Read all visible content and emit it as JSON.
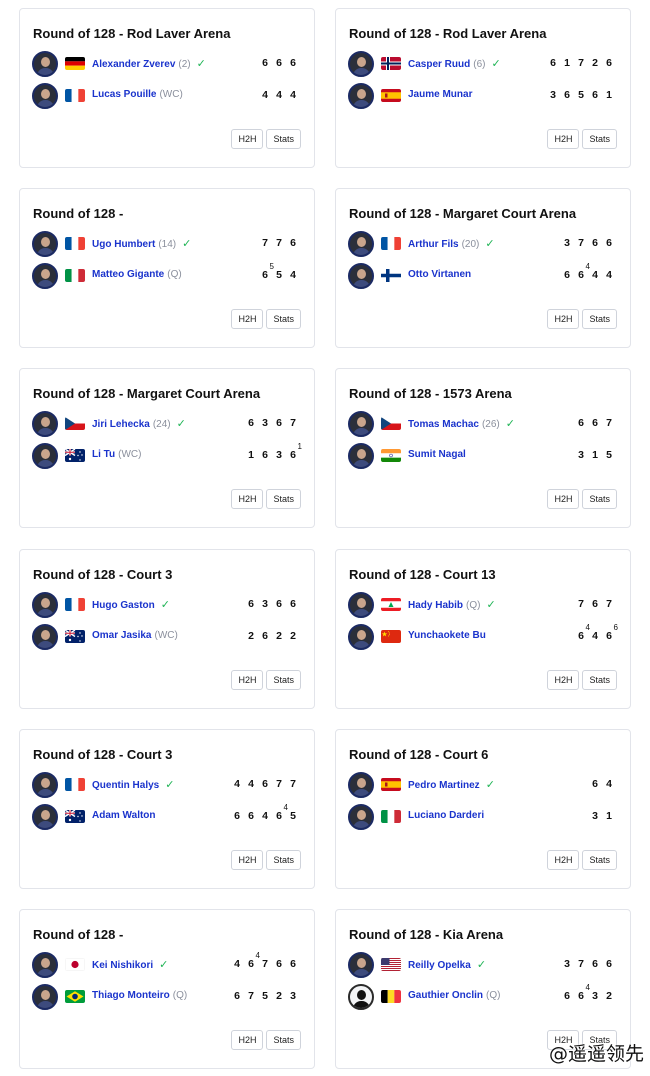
{
  "brand_colors": {
    "player_link": "#1a33cc",
    "winner_check": "#1fb455",
    "seed": "#8a8f9c",
    "card_border": "#e2e4ea"
  },
  "buttons": {
    "h2h": "H2H",
    "stats": "Stats"
  },
  "icons": {
    "winner": "check-icon",
    "avatar": "player-avatar"
  },
  "watermark": "@遥遥领先",
  "matches": [
    {
      "title": "Round of 128 - Rod Laver Arena",
      "players": [
        {
          "name": "Alexander Zverev",
          "seed": "(2)",
          "flag": "germany",
          "winner": true,
          "scores": [
            "6",
            "6",
            "6"
          ],
          "tiebreaks": [
            "",
            "",
            ""
          ]
        },
        {
          "name": "Lucas Pouille",
          "seed": "(WC)",
          "flag": "france",
          "winner": false,
          "scores": [
            "4",
            "4",
            "4"
          ],
          "tiebreaks": [
            "",
            "",
            ""
          ]
        }
      ]
    },
    {
      "title": "Round of 128 - Rod Laver Arena",
      "players": [
        {
          "name": "Casper Ruud",
          "seed": "(6)",
          "flag": "norway",
          "winner": true,
          "scores": [
            "6",
            "1",
            "7",
            "2",
            "6"
          ],
          "tiebreaks": [
            "",
            "",
            "",
            "",
            ""
          ]
        },
        {
          "name": "Jaume Munar",
          "seed": "",
          "flag": "spain",
          "winner": false,
          "scores": [
            "3",
            "6",
            "5",
            "6",
            "1"
          ],
          "tiebreaks": [
            "",
            "",
            "",
            "",
            ""
          ]
        }
      ]
    },
    {
      "title": "Round of 128 -",
      "players": [
        {
          "name": "Ugo Humbert",
          "seed": "(14)",
          "flag": "france",
          "winner": true,
          "scores": [
            "7",
            "7",
            "6"
          ],
          "tiebreaks": [
            "",
            "",
            ""
          ]
        },
        {
          "name": "Matteo Gigante",
          "seed": "(Q)",
          "flag": "italy",
          "winner": false,
          "scores": [
            "6",
            "5",
            "4"
          ],
          "tiebreaks": [
            "5",
            "",
            ""
          ]
        }
      ]
    },
    {
      "title": "Round of 128 - Margaret Court Arena",
      "players": [
        {
          "name": "Arthur Fils",
          "seed": "(20)",
          "flag": "france",
          "winner": true,
          "scores": [
            "3",
            "7",
            "6",
            "6"
          ],
          "tiebreaks": [
            "",
            "",
            "",
            ""
          ]
        },
        {
          "name": "Otto Virtanen",
          "seed": "",
          "flag": "finland",
          "winner": false,
          "scores": [
            "6",
            "6",
            "4",
            "4"
          ],
          "tiebreaks": [
            "",
            "4",
            "",
            ""
          ]
        }
      ]
    },
    {
      "title": "Round of 128 - Margaret Court Arena",
      "players": [
        {
          "name": "Jiri Lehecka",
          "seed": "(24)",
          "flag": "czechia",
          "winner": true,
          "scores": [
            "6",
            "3",
            "6",
            "7"
          ],
          "tiebreaks": [
            "",
            "",
            "",
            ""
          ]
        },
        {
          "name": "Li Tu",
          "seed": "(WC)",
          "flag": "australia",
          "winner": false,
          "scores": [
            "1",
            "6",
            "3",
            "6"
          ],
          "tiebreaks": [
            "",
            "",
            "",
            "1"
          ]
        }
      ]
    },
    {
      "title": "Round of 128 - 1573 Arena",
      "players": [
        {
          "name": "Tomas Machac",
          "seed": "(26)",
          "flag": "czechia",
          "winner": true,
          "scores": [
            "6",
            "6",
            "7"
          ],
          "tiebreaks": [
            "",
            "",
            ""
          ]
        },
        {
          "name": "Sumit Nagal",
          "seed": "",
          "flag": "india",
          "winner": false,
          "scores": [
            "3",
            "1",
            "5"
          ],
          "tiebreaks": [
            "",
            "",
            ""
          ]
        }
      ]
    },
    {
      "title": "Round of 128 - Court 3",
      "players": [
        {
          "name": "Hugo Gaston",
          "seed": "",
          "flag": "france",
          "winner": true,
          "scores": [
            "6",
            "3",
            "6",
            "6"
          ],
          "tiebreaks": [
            "",
            "",
            "",
            ""
          ]
        },
        {
          "name": "Omar Jasika",
          "seed": "(WC)",
          "flag": "australia",
          "winner": false,
          "scores": [
            "2",
            "6",
            "2",
            "2"
          ],
          "tiebreaks": [
            "",
            "",
            "",
            ""
          ]
        }
      ]
    },
    {
      "title": "Round of 128 - Court 13",
      "players": [
        {
          "name": "Hady Habib",
          "seed": "(Q)",
          "flag": "lebanon",
          "winner": true,
          "scores": [
            "7",
            "6",
            "7"
          ],
          "tiebreaks": [
            "",
            "",
            ""
          ]
        },
        {
          "name": "Yunchaokete Bu",
          "seed": "",
          "flag": "china",
          "winner": false,
          "scores": [
            "6",
            "4",
            "6"
          ],
          "tiebreaks": [
            "4",
            "",
            "6"
          ]
        }
      ]
    },
    {
      "title": "Round of 128 - Court 3",
      "players": [
        {
          "name": "Quentin Halys",
          "seed": "",
          "flag": "france",
          "winner": true,
          "scores": [
            "4",
            "4",
            "6",
            "7",
            "7"
          ],
          "tiebreaks": [
            "",
            "",
            "",
            "",
            ""
          ]
        },
        {
          "name": "Adam Walton",
          "seed": "",
          "flag": "australia",
          "winner": false,
          "scores": [
            "6",
            "6",
            "4",
            "6",
            "5"
          ],
          "tiebreaks": [
            "",
            "",
            "",
            "4",
            ""
          ]
        }
      ]
    },
    {
      "title": "Round of 128 - Court 6",
      "players": [
        {
          "name": "Pedro Martinez",
          "seed": "",
          "flag": "spain",
          "winner": true,
          "scores": [
            "6",
            "4"
          ],
          "tiebreaks": [
            "",
            ""
          ]
        },
        {
          "name": "Luciano Darderi",
          "seed": "",
          "flag": "italy",
          "winner": false,
          "scores": [
            "3",
            "1"
          ],
          "tiebreaks": [
            "",
            ""
          ]
        }
      ]
    },
    {
      "title": "Round of 128 -",
      "players": [
        {
          "name": "Kei Nishikori",
          "seed": "",
          "flag": "japan",
          "winner": true,
          "scores": [
            "4",
            "6",
            "7",
            "6",
            "6"
          ],
          "tiebreaks": [
            "",
            "4",
            "",
            "",
            ""
          ]
        },
        {
          "name": "Thiago Monteiro",
          "seed": "(Q)",
          "flag": "brazil",
          "winner": false,
          "scores": [
            "6",
            "7",
            "5",
            "2",
            "3"
          ],
          "tiebreaks": [
            "",
            "",
            "",
            "",
            ""
          ]
        }
      ]
    },
    {
      "title": "Round of 128 - Kia Arena",
      "players": [
        {
          "name": "Reilly Opelka",
          "seed": "",
          "flag": "usa",
          "winner": true,
          "scores": [
            "3",
            "7",
            "6",
            "6"
          ],
          "tiebreaks": [
            "",
            "",
            "",
            ""
          ]
        },
        {
          "name": "Gauthier Onclin",
          "seed": "(Q)",
          "flag": "belgium",
          "winner": false,
          "scores": [
            "6",
            "6",
            "3",
            "2"
          ],
          "tiebreaks": [
            "",
            "4",
            "",
            ""
          ]
        }
      ]
    }
  ]
}
